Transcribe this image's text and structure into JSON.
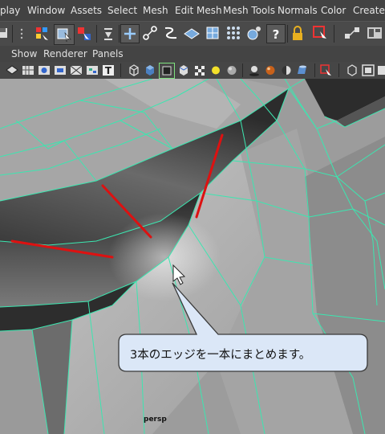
{
  "menu": {
    "items": [
      "play",
      "Window",
      "Assets",
      "Select",
      "Mesh",
      "Edit Mesh",
      "Mesh Tools",
      "Normals",
      "Color",
      "Create U"
    ]
  },
  "panel_menu": {
    "items": [
      "Show",
      "Renderer",
      "Panels"
    ]
  },
  "viewport": {
    "camera_label": "persp"
  },
  "callout": {
    "text": "3本のエッジを一本にまとめます。"
  },
  "colors": {
    "wireframe": "#3ce6b0",
    "annotation": "#dd1111",
    "callout_fill": "#dbe7f7"
  },
  "shelf_icons": [
    "multi-component-icon",
    "select-tool-icon",
    "lasso-icon",
    "paint-select-icon",
    "add-icon",
    "move-pivot-icon",
    "bridge-icon",
    "extrude-icon",
    "smooth-icon",
    "combine-icon",
    "sculpt-icon",
    "help-icon",
    "lock-icon",
    "select-outline-icon",
    "connect-icon",
    "layout-icon"
  ],
  "panel_icons": [
    "shading-icon",
    "grid-icon",
    "camera-icon",
    "wireframe-icon",
    "checker-icon",
    "texture-icon",
    "text-icon",
    "cube-icon",
    "box-icon",
    "highlight-cube-icon",
    "uv-icon",
    "checker-icon",
    "light-icon",
    "sphere-icon",
    "shadow-icon",
    "orb-icon",
    "half-sphere-icon",
    "cylinder-icon",
    "select-icon",
    "isolate-icon",
    "frame-icon"
  ]
}
